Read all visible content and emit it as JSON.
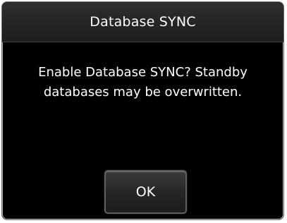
{
  "dialog": {
    "title": "Database SYNC",
    "message_line1": "Enable Database SYNC? Standby",
    "message_line2": "databases may be overwritten.",
    "ok_label": "OK"
  },
  "colors": {
    "background": "#000000",
    "text": "#ffffff",
    "title_bar": "#262626",
    "button_border": "#5e5e5e"
  }
}
